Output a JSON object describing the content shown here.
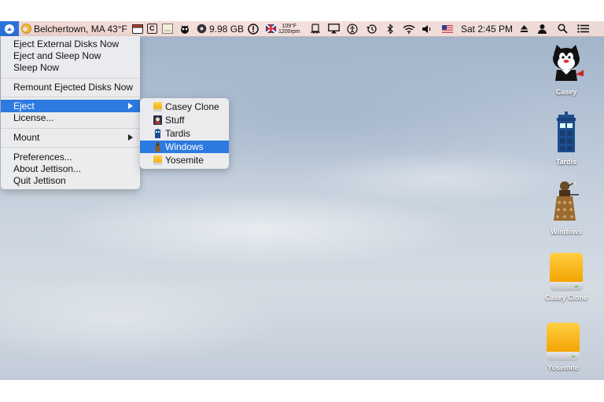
{
  "menubar": {
    "weather": "Belchertown, MA 43°F",
    "c_box": "C",
    "disk_free": "9.98 GB",
    "temp_line1": "109°F",
    "temp_line2": "1200rpm",
    "clock": "Sat 2:45 PM",
    "icons": [
      "jettison-icon",
      "weather-icon",
      "calendar-icon",
      "c-icon",
      "notepad-icon",
      "monster-icon",
      "disk-icon",
      "info-icon",
      "flag-icon",
      "sensor-icon",
      "hanger-icon",
      "airplay-icon",
      "accessibility-icon",
      "time-machine-icon",
      "bluetooth-icon",
      "wifi-icon",
      "volume-icon",
      "us-flag-icon",
      "eject-icon",
      "user-icon",
      "spotlight-icon",
      "notification-center-icon"
    ],
    "accent": "#2a73d9"
  },
  "menu": {
    "items": [
      {
        "label": "Eject External Disks Now"
      },
      {
        "label": "Eject and Sleep Now"
      },
      {
        "label": "Sleep Now"
      },
      {
        "label": "Remount Ejected Disks Now"
      },
      {
        "label": "Eject",
        "submenu": true,
        "highlighted": true
      },
      {
        "label": "License..."
      },
      {
        "label": "Mount",
        "submenu": true
      },
      {
        "label": "Preferences..."
      },
      {
        "label": "About Jettison..."
      },
      {
        "label": "Quit Jettison"
      }
    ]
  },
  "submenu": {
    "items": [
      {
        "label": "Casey Clone",
        "icon": "drive-icon"
      },
      {
        "label": "Stuff",
        "icon": "stuff-icon"
      },
      {
        "label": "Tardis",
        "icon": "tardis-icon"
      },
      {
        "label": "Windows",
        "icon": "dalek-icon",
        "highlighted": true
      },
      {
        "label": "Yosemite",
        "icon": "drive-icon"
      }
    ],
    "highlight_color": "#2d7ae0"
  },
  "desktop": {
    "icons": [
      {
        "label": "Casey",
        "icon": "cat-icon"
      },
      {
        "label": "Tardis",
        "icon": "tardis-icon"
      },
      {
        "label": "Windows",
        "icon": "dalek-icon"
      },
      {
        "label": "Casey Clone",
        "icon": "drive-icon"
      },
      {
        "label": "Yosemite",
        "icon": "drive-icon"
      }
    ]
  }
}
